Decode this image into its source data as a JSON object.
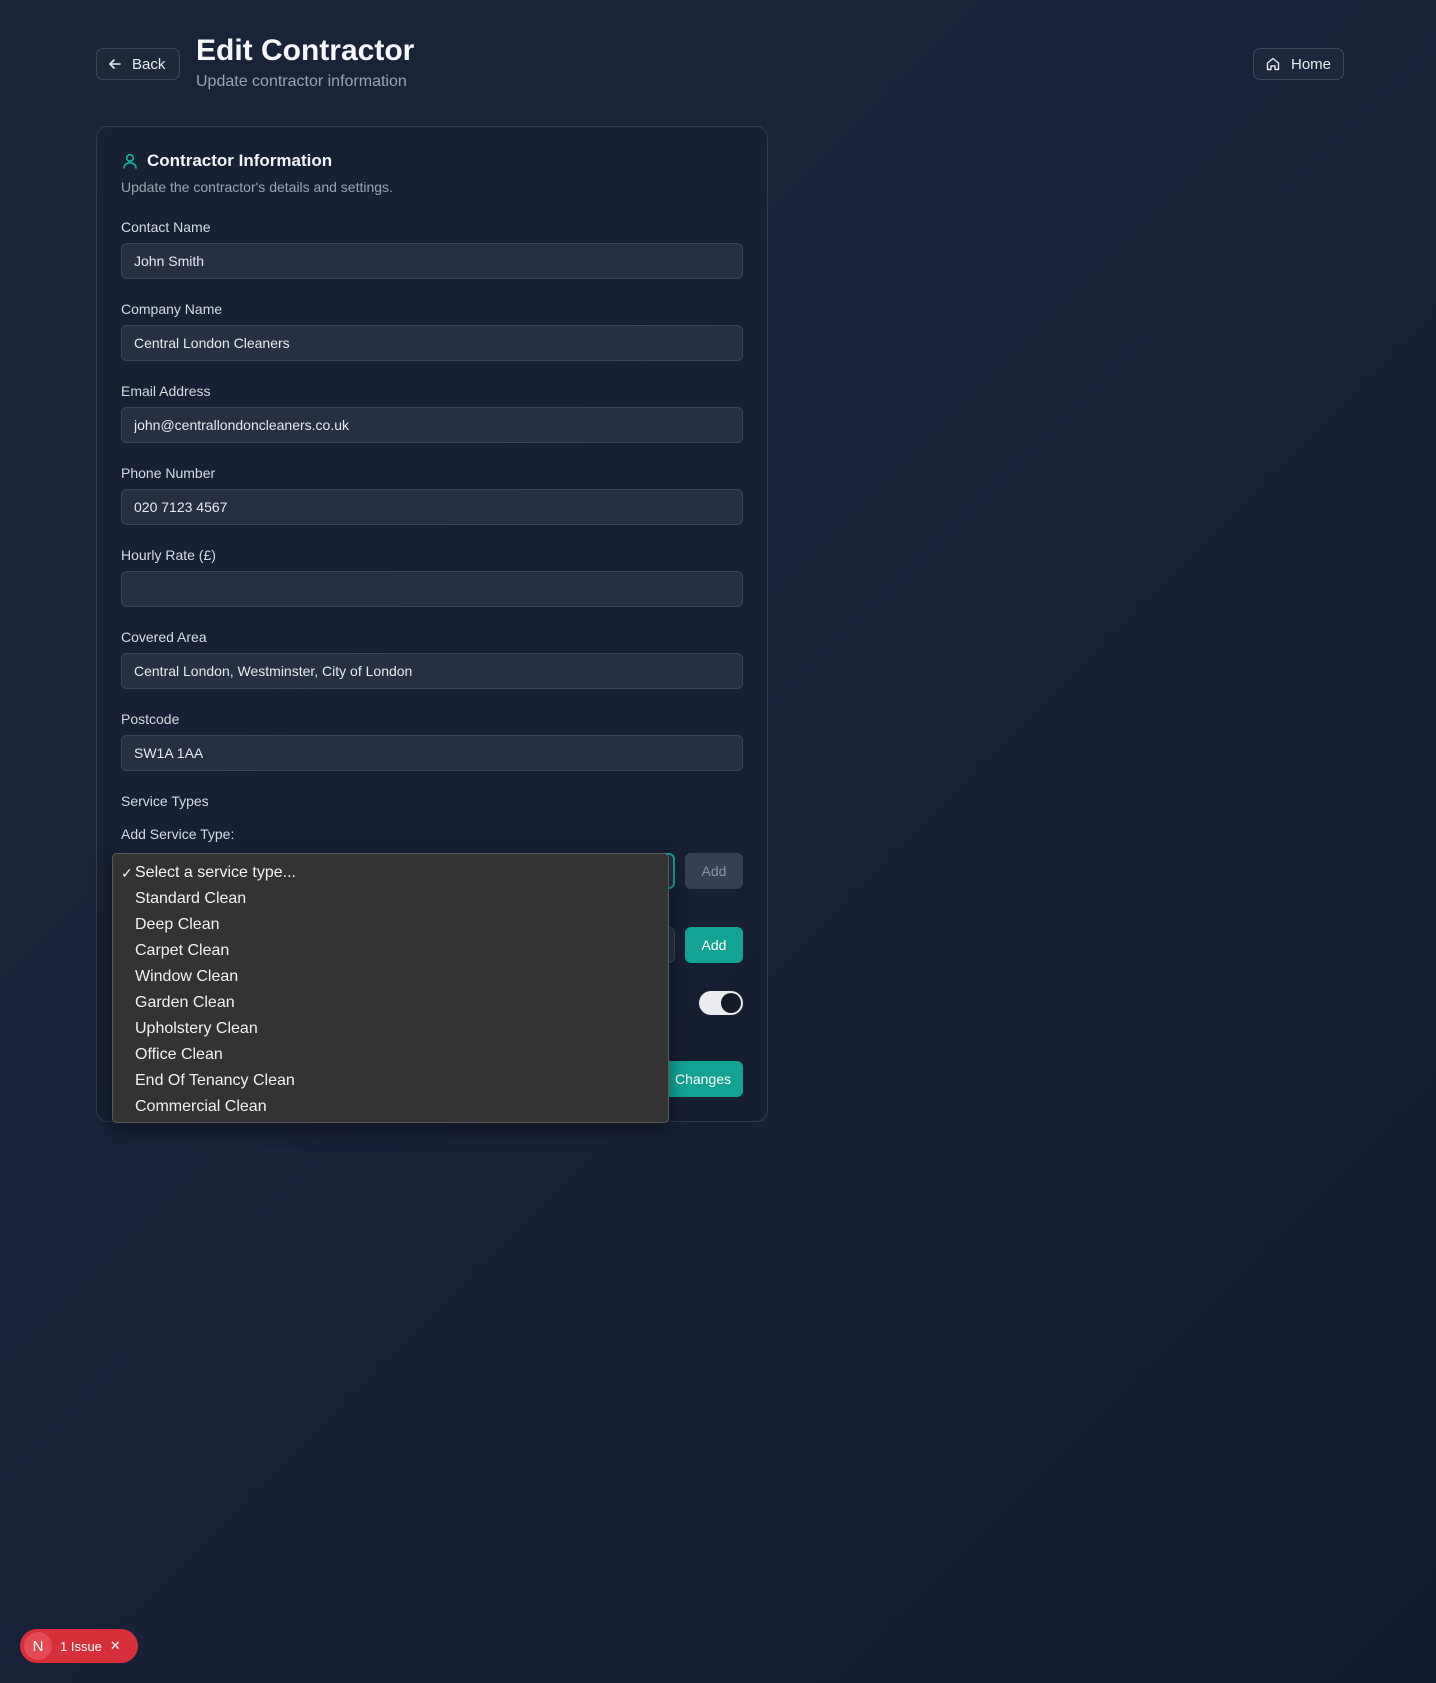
{
  "header": {
    "back_label": "Back",
    "title": "Edit Contractor",
    "subtitle": "Update contractor information",
    "home_label": "Home"
  },
  "card": {
    "title": "Contractor Information",
    "description": "Update the contractor's details and settings."
  },
  "fields": {
    "contact_name": {
      "label": "Contact Name",
      "value": "John Smith"
    },
    "company_name": {
      "label": "Company Name",
      "value": "Central London Cleaners"
    },
    "email": {
      "label": "Email Address",
      "value": "john@centrallondoncleaners.co.uk"
    },
    "phone": {
      "label": "Phone Number",
      "value": "020 7123 4567"
    },
    "hourly_rate": {
      "label": "Hourly Rate (£)",
      "value": ""
    },
    "covered_area": {
      "label": "Covered Area",
      "value": "Central London, Westminster, City of London"
    },
    "postcode": {
      "label": "Postcode",
      "value": "SW1A 1AA"
    }
  },
  "service_types": {
    "label": "Service Types",
    "add_label": "Add Service Type:",
    "add_button": "Add",
    "add_button_2": "Add",
    "options": [
      "Select a service type...",
      "Standard Clean",
      "Deep Clean",
      "Carpet Clean",
      "Window Clean",
      "Garden Clean",
      "Upholstery Clean",
      "Office Clean",
      "End Of Tenancy Clean",
      "Commercial Clean"
    ],
    "selected_index": 0,
    "check_mark": "✓"
  },
  "toggle": {
    "on": true
  },
  "save_button_visible_text": "Changes",
  "issues_badge": {
    "logo_letter": "N",
    "label": "1 Issue",
    "close_glyph": "✕"
  },
  "colors": {
    "accent": "#12a394",
    "background": "#1b2538",
    "issue_red": "#d7303a"
  },
  "icons": {
    "back": "arrow-left-icon",
    "home": "home-icon",
    "card": "user-icon"
  }
}
